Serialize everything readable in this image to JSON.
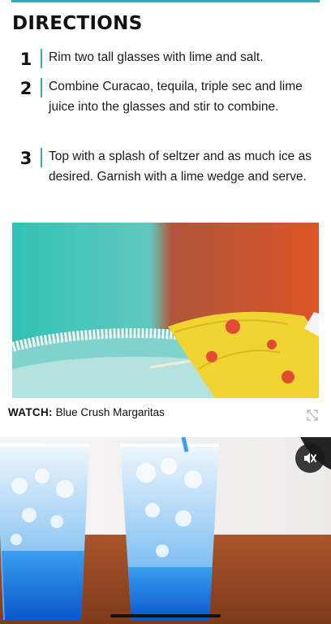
{
  "directions": {
    "heading": "DIRECTIONS",
    "steps": [
      {
        "number": "1",
        "text": "Rim two tall glasses with lime and salt."
      },
      {
        "number": "2",
        "text": "Combine Curacao, tequila, triple sec and lime juice into the glasses and stir to combine."
      },
      {
        "number": "3",
        "text": "Top with a splash of seltzer and as much ice as desired. Garnish with a lime wedge and serve."
      }
    ]
  },
  "video": {
    "watch_prefix": "WATCH:",
    "title": "Blue Crush Margaritas",
    "expand_icon": "expand-icon",
    "mute_icon": "muted-speaker-icon"
  },
  "colors": {
    "accent": "#3aa7b2"
  }
}
